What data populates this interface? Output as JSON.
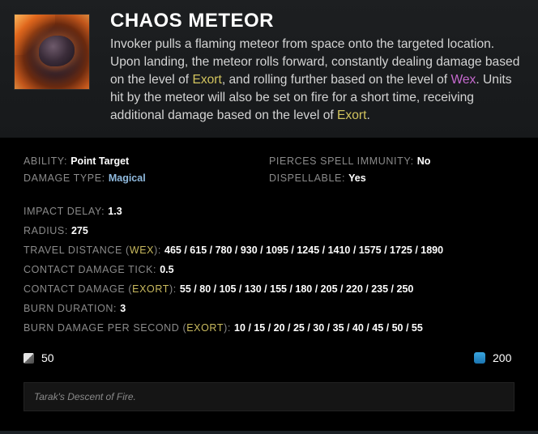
{
  "ability": {
    "name": "CHAOS METEOR",
    "icon": "chaos-meteor-icon",
    "description_parts": [
      "Invoker pulls a flaming meteor from space onto the targeted location. Upon landing, the meteor rolls forward, constantly dealing damage based on the level of ",
      "Exort",
      ", and rolling further based on the level of ",
      "Wex",
      ". Units hit by the meteor will also be set on fire for a short time, receiving additional damage based on the level of ",
      "Exort",
      "."
    ]
  },
  "info": {
    "ability_label": "ABILITY:",
    "ability_value": "Point Target",
    "damage_type_label": "DAMAGE TYPE:",
    "damage_type_value": "Magical",
    "pierces_label": "PIERCES SPELL IMMUNITY:",
    "pierces_value": "No",
    "dispellable_label": "DISPELLABLE:",
    "dispellable_value": "Yes"
  },
  "stats": {
    "impact_delay_label": "IMPACT DELAY:",
    "impact_delay_value": "1.3",
    "radius_label": "RADIUS:",
    "radius_value": "275",
    "travel_label_pre": "TRAVEL DISTANCE (",
    "travel_label_kw": "WEX",
    "travel_label_post": "):",
    "travel_value": "465 / 615 / 780 / 930 / 1095 / 1245 / 1410 / 1575 / 1725 / 1890",
    "tick_label": "CONTACT DAMAGE TICK:",
    "tick_value": "0.5",
    "contact_label_pre": "CONTACT DAMAGE (",
    "contact_label_kw": "EXORT",
    "contact_label_post": "):",
    "contact_value": "55 / 80 / 105 / 130 / 155 / 180 / 205 / 220 / 235 / 250",
    "burn_duration_label": "BURN DURATION:",
    "burn_duration_value": "3",
    "burn_dps_label_pre": "BURN DAMAGE PER SECOND (",
    "burn_dps_label_kw": "EXORT",
    "burn_dps_label_post": "):",
    "burn_dps_value": "10 / 15 / 20 / 25 / 30 / 35 / 40 / 45 / 50 / 55"
  },
  "costs": {
    "cooldown": "50",
    "cooldown_icon": "cooldown-icon",
    "mana": "200",
    "mana_icon": "mana-icon"
  },
  "lore": "Tarak's Descent of Fire.",
  "colors": {
    "exort": "#d2c45e",
    "wex": "#c76ad0",
    "magical": "#8fb9dd",
    "mana": "#2a90cc"
  }
}
